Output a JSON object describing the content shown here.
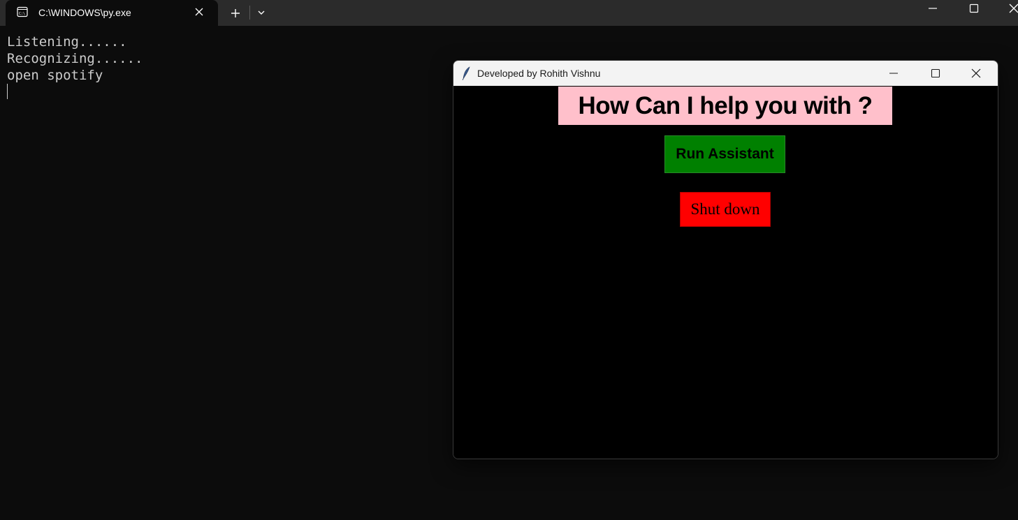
{
  "terminal": {
    "tab_title": "C:\\WINDOWS\\py.exe",
    "icons": {
      "tab": "terminal-icon",
      "tab_close": "close-icon",
      "new_tab": "plus-icon",
      "dropdown": "chevron-down-icon",
      "minimize": "minimize-icon",
      "maximize": "maximize-icon",
      "close": "close-icon"
    },
    "lines": [
      "Listening......",
      "Recognizing......",
      "open spotify"
    ],
    "colors": {
      "background": "#0c0c0c",
      "titlebar": "#2b2b2b",
      "text": "#cccccc"
    }
  },
  "tk_window": {
    "title": "Developed by Rohith Vishnu",
    "icons": {
      "app": "feather-icon",
      "minimize": "minimize-icon",
      "maximize": "maximize-icon",
      "close": "close-icon"
    },
    "heading": "How Can I help you with ?",
    "run_button_label": "Run Assistant",
    "shutdown_button_label": "Shut down",
    "colors": {
      "background": "#000000",
      "heading_bg": "#ffc0cb",
      "run_button_bg": "#008000",
      "shutdown_button_bg": "#ff0000"
    }
  }
}
